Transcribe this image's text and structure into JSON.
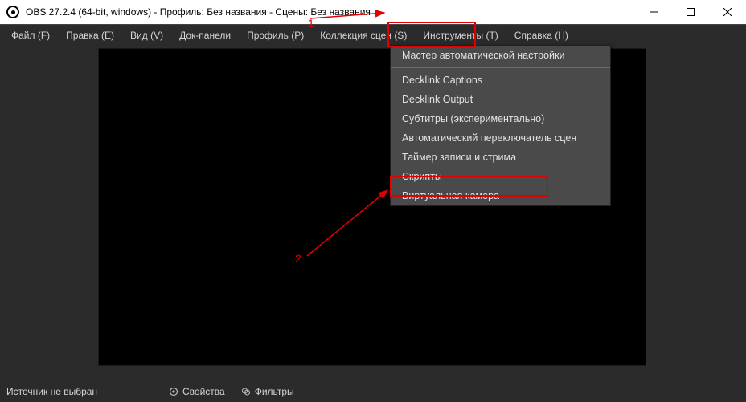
{
  "titlebar": {
    "title": "OBS 27.2.4 (64-bit, windows) - Профиль: Без названия - Сцены: Без названия"
  },
  "menubar": {
    "items": [
      "Файл (F)",
      "Правка (E)",
      "Вид (V)",
      "Док-панели",
      "Профиль (P)",
      "Коллекция сцен (S)",
      "Инструменты (T)",
      "Справка (H)"
    ]
  },
  "dropdown": {
    "items": [
      "Мастер автоматической настройки",
      "Decklink Captions",
      "Decklink Output",
      "Субтитры (экспериментально)",
      "Автоматический переключатель сцен",
      "Таймер записи и стрима",
      "Скрипты",
      "Виртуальная камера"
    ]
  },
  "annotations": {
    "num1": "1",
    "num2": "2"
  },
  "bottombar": {
    "status": "Источник не выбран",
    "properties": "Свойства",
    "filters": "Фильтры"
  }
}
